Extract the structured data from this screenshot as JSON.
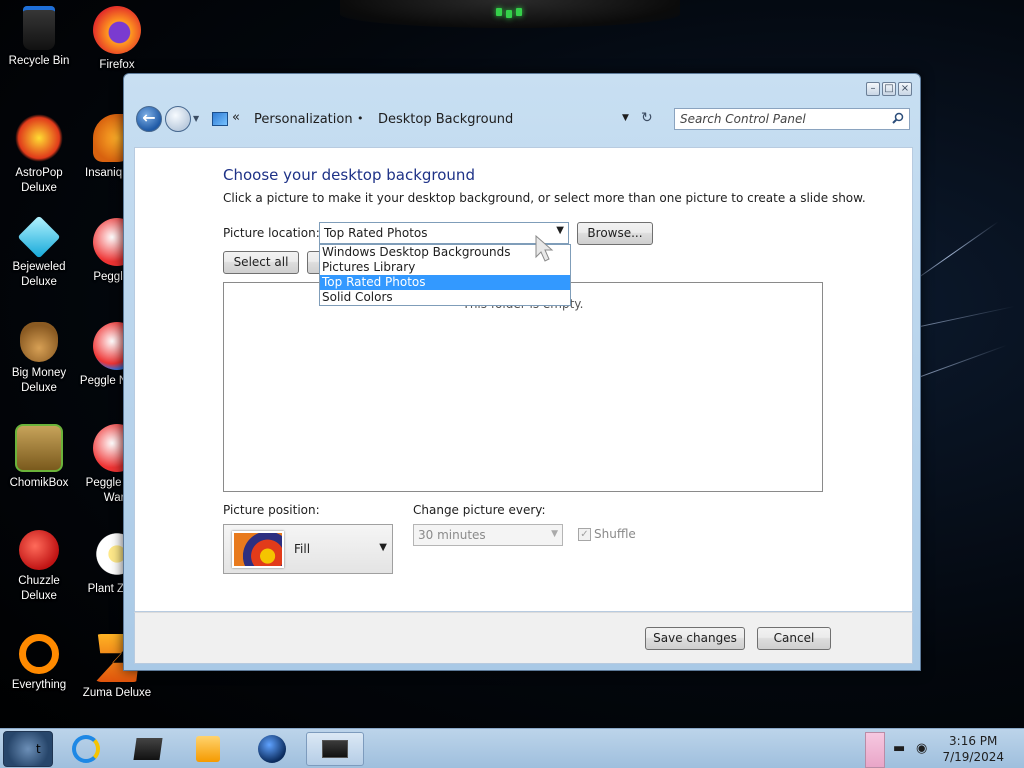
{
  "desktop": {
    "icons": [
      {
        "label": "Recycle Bin",
        "icon": "recycle-bin-icon"
      },
      {
        "label": "Firefox",
        "icon": "firefox-icon"
      },
      {
        "label": "AstroPop Deluxe",
        "icon": "astropop-icon"
      },
      {
        "label": "Insaniquarium Deluxe",
        "icon": "insaniquarium-icon",
        "visible_label": "Insaniq Delu"
      },
      {
        "label": "Bejeweled Deluxe",
        "icon": "bejeweled-icon"
      },
      {
        "label": "Peggle Deluxe",
        "icon": "peggle-icon",
        "visible_label": "Peggle D"
      },
      {
        "label": "Big Money Deluxe",
        "icon": "big-money-icon"
      },
      {
        "label": "Peggle Nights Deluxe",
        "icon": "peggle-nights-icon",
        "visible_label": "Peggle N Delu"
      },
      {
        "label": "ChomikBox",
        "icon": "chomikbox-icon"
      },
      {
        "label": "Peggle World of Warcraft",
        "icon": "peggle-wow-icon",
        "visible_label": "Peggle W of Warc"
      },
      {
        "label": "Chuzzle Deluxe",
        "icon": "chuzzle-icon"
      },
      {
        "label": "Plants vs. Zombies",
        "icon": "plants-zombies-icon",
        "visible_label": "Plant Zomb"
      },
      {
        "label": "Everything",
        "icon": "everything-search-icon"
      },
      {
        "label": "Zuma Deluxe",
        "icon": "zuma-icon"
      }
    ]
  },
  "window": {
    "breadcrumb": [
      "Personalization",
      "Desktop Background"
    ],
    "search_placeholder": "Search Control Panel",
    "heading": "Choose your desktop background",
    "subtext": "Click a picture to make it your desktop background, or select more than one picture to create a slide show.",
    "picture_location_label": "Picture location:",
    "picture_location_value": "Top Rated Photos",
    "browse_label": "Browse...",
    "select_all_label": "Select all",
    "dropdown_options": [
      "Windows Desktop Backgrounds",
      "Pictures Library",
      "Top Rated Photos",
      "Solid Colors"
    ],
    "dropdown_selected_index": 2,
    "empty_text": "This folder is empty.",
    "picture_position_label": "Picture position:",
    "picture_position_value": "Fill",
    "change_every_label": "Change picture every:",
    "change_every_value": "30 minutes",
    "shuffle_label": "Shuffle",
    "save_label": "Save changes",
    "cancel_label": "Cancel"
  },
  "taskbar": {
    "clock_time": "3:16 PM",
    "clock_date": "7/19/2024",
    "start_glyph": "t"
  },
  "colors": {
    "heading": "#1e3287",
    "selection": "#3399ff",
    "taskbar": "#bcd4ea"
  }
}
